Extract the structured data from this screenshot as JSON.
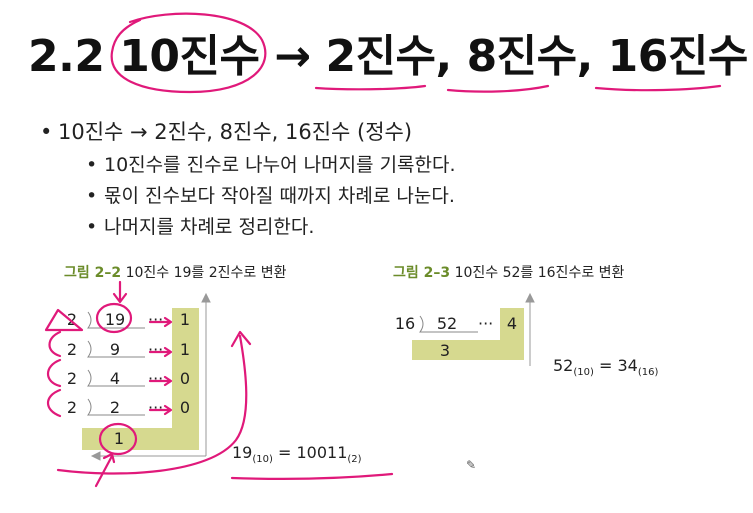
{
  "title": "2.2 10진수 → 2진수, 8진수, 16진수",
  "bullets": {
    "main": "10진수 → 2진수, 8진수, 16진수 (정수)",
    "sub": [
      "10진수를 진수로 나누어 나머지를 기록한다.",
      "몫이 진수보다 작아질 때까지 차례로 나눈다.",
      "나머지를 차례로 정리한다."
    ]
  },
  "figure1": {
    "label": "그림 2–2",
    "caption": "10진수 19를 2진수로 변환",
    "rows": [
      {
        "divisor": "2",
        "quotient": "19",
        "dots": "···",
        "remainder": "1"
      },
      {
        "divisor": "2",
        "quotient": "9",
        "dots": "···",
        "remainder": "1"
      },
      {
        "divisor": "2",
        "quotient": "4",
        "dots": "···",
        "remainder": "0"
      },
      {
        "divisor": "2",
        "quotient": "2",
        "dots": "···",
        "remainder": "0"
      }
    ],
    "final_quotient": "1",
    "result": {
      "lhs": "19",
      "lhs_base": "(10)",
      "eq": "=",
      "rhs": "10011",
      "rhs_base": "(2)"
    }
  },
  "figure2": {
    "label": "그림 2–3",
    "caption": "10진수 52를 16진수로 변환",
    "row": {
      "divisor": "16",
      "quotient": "52",
      "dots": "···",
      "remainder": "4"
    },
    "final_quotient": "3",
    "result": {
      "lhs": "52",
      "lhs_base": "(10)",
      "eq": "=",
      "rhs": "34",
      "rhs_base": "(16)"
    }
  },
  "colors": {
    "annotation": "#e0197a",
    "highlight": "#d6d98f",
    "label_green": "#6b8c2a"
  }
}
